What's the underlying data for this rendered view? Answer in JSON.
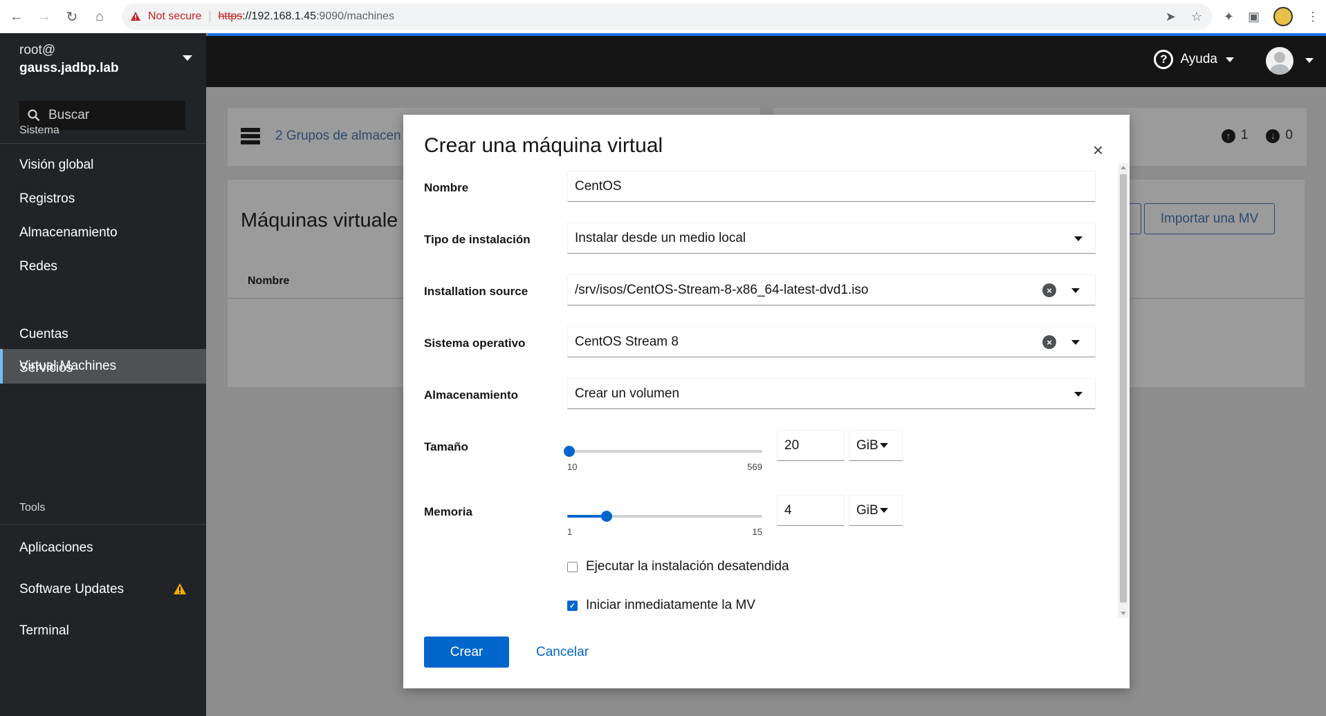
{
  "browser": {
    "not_secure": "Not secure",
    "url_scheme": "https",
    "url_host": "://192.168.1.45",
    "url_path": ":9090/machines"
  },
  "sidebar": {
    "host_user": "root@",
    "host_name": "gauss.jadbp.lab",
    "search_placeholder": "Buscar",
    "section_system": "Sistema",
    "items_system": [
      {
        "label": "Visión global"
      },
      {
        "label": "Registros"
      },
      {
        "label": "Almacenamiento"
      },
      {
        "label": "Redes"
      },
      {
        "label": "Virtual Machines"
      },
      {
        "label": "Cuentas"
      },
      {
        "label": "Servicios"
      }
    ],
    "section_tools": "Tools",
    "items_tools": [
      {
        "label": "Aplicaciones"
      },
      {
        "label": "Software Updates"
      },
      {
        "label": "Terminal"
      }
    ]
  },
  "masthead": {
    "help_label": "Ayuda"
  },
  "background": {
    "storage_pools_link": "2 Grupos de almacen",
    "count_up": "1",
    "count_down": "0",
    "vm_heading": "Máquinas virtuale",
    "col_name": "Nombre",
    "import_button": "Importar una MV"
  },
  "modal": {
    "title": "Crear una máquina virtual",
    "close": "×",
    "name_label": "Nombre",
    "name_value": "CentOS",
    "install_type_label": "Tipo de instalación",
    "install_type_value": "Instalar desde un medio local",
    "install_source_label": "Installation source",
    "install_source_value": "/srv/isos/CentOS-Stream-8-x86_64-latest-dvd1.iso",
    "os_label": "Sistema operativo",
    "os_value": "CentOS Stream 8",
    "storage_label": "Almacenamiento",
    "storage_value": "Crear un volumen",
    "size_label": "Tamaño",
    "size_min": "10",
    "size_max": "569",
    "size_value": "20",
    "size_unit": "GiB",
    "memory_label": "Memoria",
    "memory_min": "1",
    "memory_max": "15",
    "memory_value": "4",
    "memory_unit": "GiB",
    "unattended_label": "Ejecutar la instalación desatendida",
    "unattended_checked": false,
    "start_immediately_label": "Iniciar inmediatamente la MV",
    "start_immediately_checked": true,
    "create_button": "Crear",
    "cancel_button": "Cancelar"
  }
}
